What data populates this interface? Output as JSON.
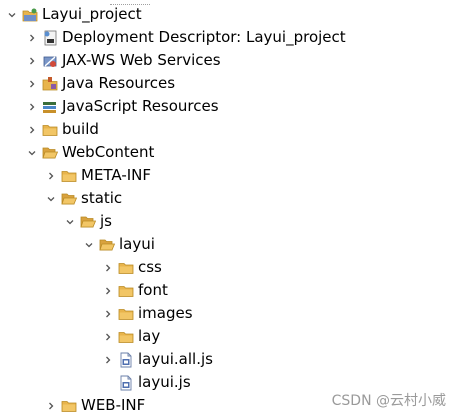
{
  "tree": {
    "project": {
      "label": "Layui_project",
      "icon": "project-icon",
      "state": "expanded"
    },
    "deployment_descriptor": {
      "label": "Deployment Descriptor: Layui_project",
      "icon": "deployment-descriptor-icon",
      "state": "collapsed"
    },
    "jax_ws": {
      "label": "JAX-WS Web Services",
      "icon": "web-services-icon",
      "state": "collapsed"
    },
    "java_resources": {
      "label": "Java Resources",
      "icon": "java-resources-icon",
      "state": "collapsed"
    },
    "javascript_resources": {
      "label": "JavaScript Resources",
      "icon": "javascript-resources-icon",
      "state": "collapsed"
    },
    "build": {
      "label": "build",
      "icon": "folder-icon",
      "state": "collapsed"
    },
    "webcontent": {
      "label": "WebContent",
      "icon": "folder-open-icon",
      "state": "expanded"
    },
    "meta_inf": {
      "label": "META-INF",
      "icon": "folder-icon",
      "state": "collapsed"
    },
    "static": {
      "label": "static",
      "icon": "folder-open-icon",
      "state": "expanded"
    },
    "js": {
      "label": "js",
      "icon": "folder-open-icon",
      "state": "expanded"
    },
    "layui": {
      "label": "layui",
      "icon": "folder-open-icon",
      "state": "expanded"
    },
    "css": {
      "label": "css",
      "icon": "folder-icon",
      "state": "collapsed"
    },
    "font": {
      "label": "font",
      "icon": "folder-icon",
      "state": "collapsed"
    },
    "images": {
      "label": "images",
      "icon": "folder-icon",
      "state": "collapsed"
    },
    "lay": {
      "label": "lay",
      "icon": "folder-icon",
      "state": "collapsed"
    },
    "layui_all_js": {
      "label": "layui.all.js",
      "icon": "js-file-icon",
      "state": "collapsed"
    },
    "layui_js": {
      "label": "layui.js",
      "icon": "js-file-icon",
      "state": "none"
    },
    "web_inf": {
      "label": "WEB-INF",
      "icon": "folder-icon",
      "state": "collapsed"
    }
  },
  "watermark": "CSDN @云村小威",
  "colors": {
    "folder": "#e8b44c",
    "folder_edge": "#b98a24",
    "twisty": "#555555"
  }
}
